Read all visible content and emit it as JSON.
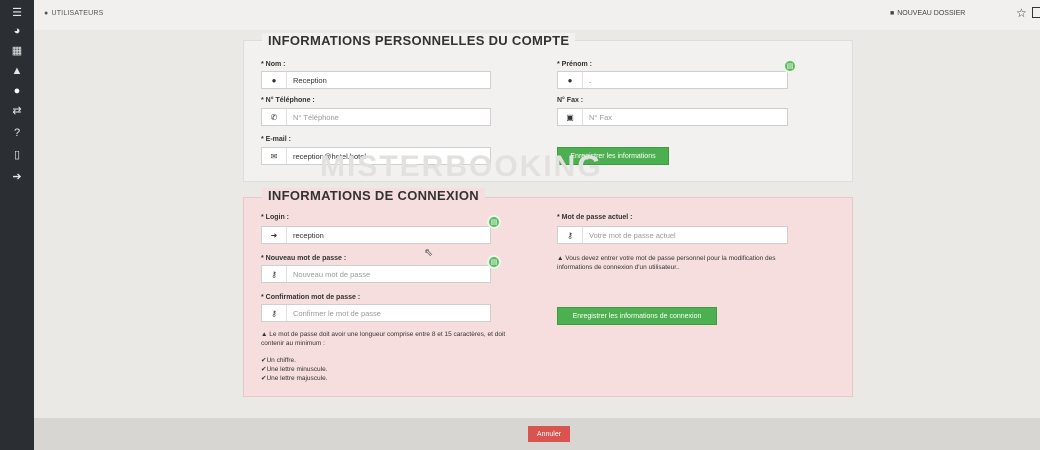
{
  "sidebar": {
    "icons": [
      {
        "name": "menu-icon",
        "glyph": "☰"
      },
      {
        "name": "dashboard-icon",
        "glyph": "◕"
      },
      {
        "name": "calendar-icon",
        "glyph": "▦"
      },
      {
        "name": "bell-icon",
        "glyph": "🔔"
      },
      {
        "name": "user-icon",
        "glyph": "●"
      },
      {
        "name": "transfer-icon",
        "glyph": "⇄"
      },
      {
        "name": "help-icon",
        "glyph": "?"
      },
      {
        "name": "tablet-icon",
        "glyph": "▯"
      },
      {
        "name": "logout-icon",
        "glyph": "➔"
      }
    ]
  },
  "topbar": {
    "breadcrumb": "UTILISATEURS",
    "new_folder_label": "NOUVEAU DOSSIER",
    "star_glyph": "☆"
  },
  "personal": {
    "legend": "INFORMATIONS PERSONNELLES DU COMPTE",
    "nom_label": "* Nom :",
    "nom_value": "Reception",
    "prenom_label": "* Prénom :",
    "prenom_value": ".",
    "telephone_label": "* N° Téléphone :",
    "telephone_placeholder": "N° Téléphone",
    "fax_label": "N° Fax :",
    "fax_placeholder": "N° Fax",
    "email_label": "* E-mail :",
    "email_value": "reception@hotel.hotel",
    "save_button": "Enregistrer les informations"
  },
  "watermark": "MISTERBOOKING",
  "connexion": {
    "legend": "INFORMATIONS DE CONNEXION",
    "login_label": "* Login :",
    "login_value": "reception",
    "current_pw_label": "* Mot de passe actuel :",
    "current_pw_placeholder": "Votre mot de passe actuel",
    "new_pw_label": "* Nouveau mot de passe :",
    "new_pw_placeholder": "Nouveau mot de passe",
    "confirm_pw_label": "* Confirmation mot de passe :",
    "confirm_pw_placeholder": "Confirmer le mot de passe",
    "warning_right": "Vous devez entrer votre mot de passe personnel pour la modification des informations de connexion d'un utilisateur..",
    "warning_left": "Le mot de passe doit avoir une longueur comprise entre 8 et 15 caractères, et doit contenir au minimum :",
    "rules": [
      "Un chiffre.",
      "Une lettre minuscule.",
      "Une lettre majuscule."
    ],
    "save_button": "Enregistrer les informations de connexion"
  },
  "cancel_button": "Annuler"
}
